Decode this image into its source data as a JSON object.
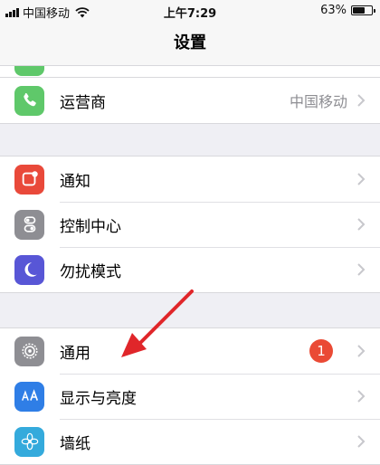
{
  "status_bar": {
    "carrier": "中国移动",
    "time": "上午7:29",
    "battery_percent": "63%",
    "battery_level": 0.63
  },
  "nav": {
    "title": "设置"
  },
  "groups": [
    {
      "rows": [
        {
          "label": "运营商",
          "value": "中国移动",
          "icon": "phone-icon",
          "color": "#5fc86a"
        }
      ]
    },
    {
      "rows": [
        {
          "label": "通知",
          "icon": "notification-icon",
          "color": "#e9493a"
        },
        {
          "label": "控制中心",
          "icon": "control-center-icon",
          "color": "#8e8e93"
        },
        {
          "label": "勿扰模式",
          "icon": "moon-icon",
          "color": "#5856d6"
        }
      ]
    },
    {
      "rows": [
        {
          "label": "通用",
          "badge": "1",
          "icon": "gear-icon",
          "color": "#8e8e93"
        },
        {
          "label": "显示与亮度",
          "icon": "display-brightness-icon",
          "color": "#2f7ee6"
        },
        {
          "label": "墙纸",
          "icon": "wallpaper-flower-icon",
          "color": "#34aadc"
        }
      ]
    }
  ],
  "annotation": {
    "color": "#e0262a"
  }
}
